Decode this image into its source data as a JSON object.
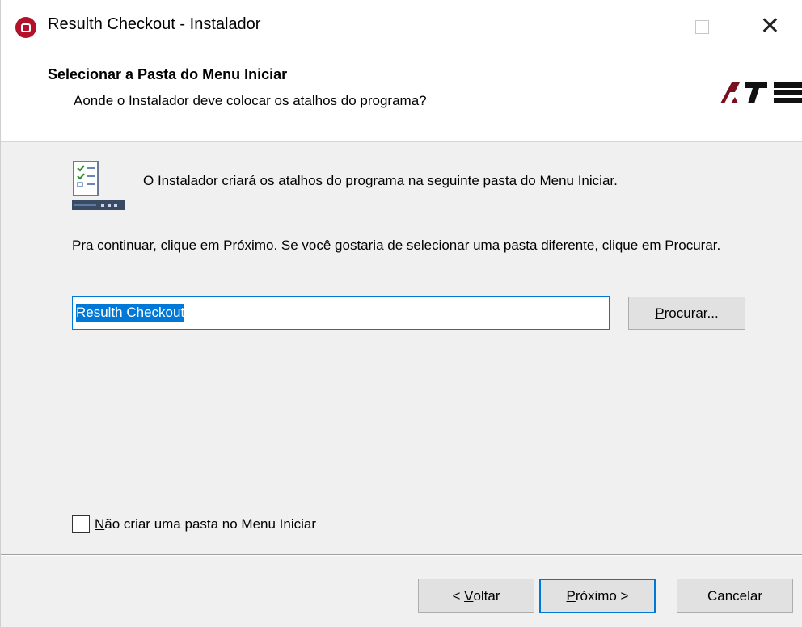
{
  "window": {
    "title": "Resulth Checkout - Instalador",
    "minimize_icon": "minimize-icon",
    "maximize_icon": "maximize-icon",
    "close_icon": "close-icon",
    "close_glyph": "✕"
  },
  "header": {
    "title": "Selecionar a Pasta do Menu Iniciar",
    "subtitle": "Aonde o Instalador deve colocar os atalhos do programa?",
    "logo_text": "ATS",
    "logo_colors": [
      "#7a0f1e",
      "#000000"
    ]
  },
  "main": {
    "info_text": "O Instalador criará os atalhos do programa na seguinte pasta do Menu Iniciar.",
    "continue_text": "Pra continuar, clique em Próximo. Se você gostaria de selecionar uma pasta diferente, clique em Procurar.",
    "folder_value": "Resulth Checkout",
    "browse_label_pre": "",
    "browse_label_key": "P",
    "browse_label_post": "rocurar...",
    "no_folder_checkbox": {
      "checked": false,
      "label_key": "N",
      "label_post": "ão criar uma pasta no Menu Iniciar"
    }
  },
  "footer": {
    "back_label_pre": "< ",
    "back_label_key": "V",
    "back_label_post": "oltar",
    "next_label_key": "P",
    "next_label_post": "róximo >",
    "cancel_label": "Cancelar"
  },
  "colors": {
    "accent": "#0078d7",
    "app_icon": "#b3122a"
  }
}
